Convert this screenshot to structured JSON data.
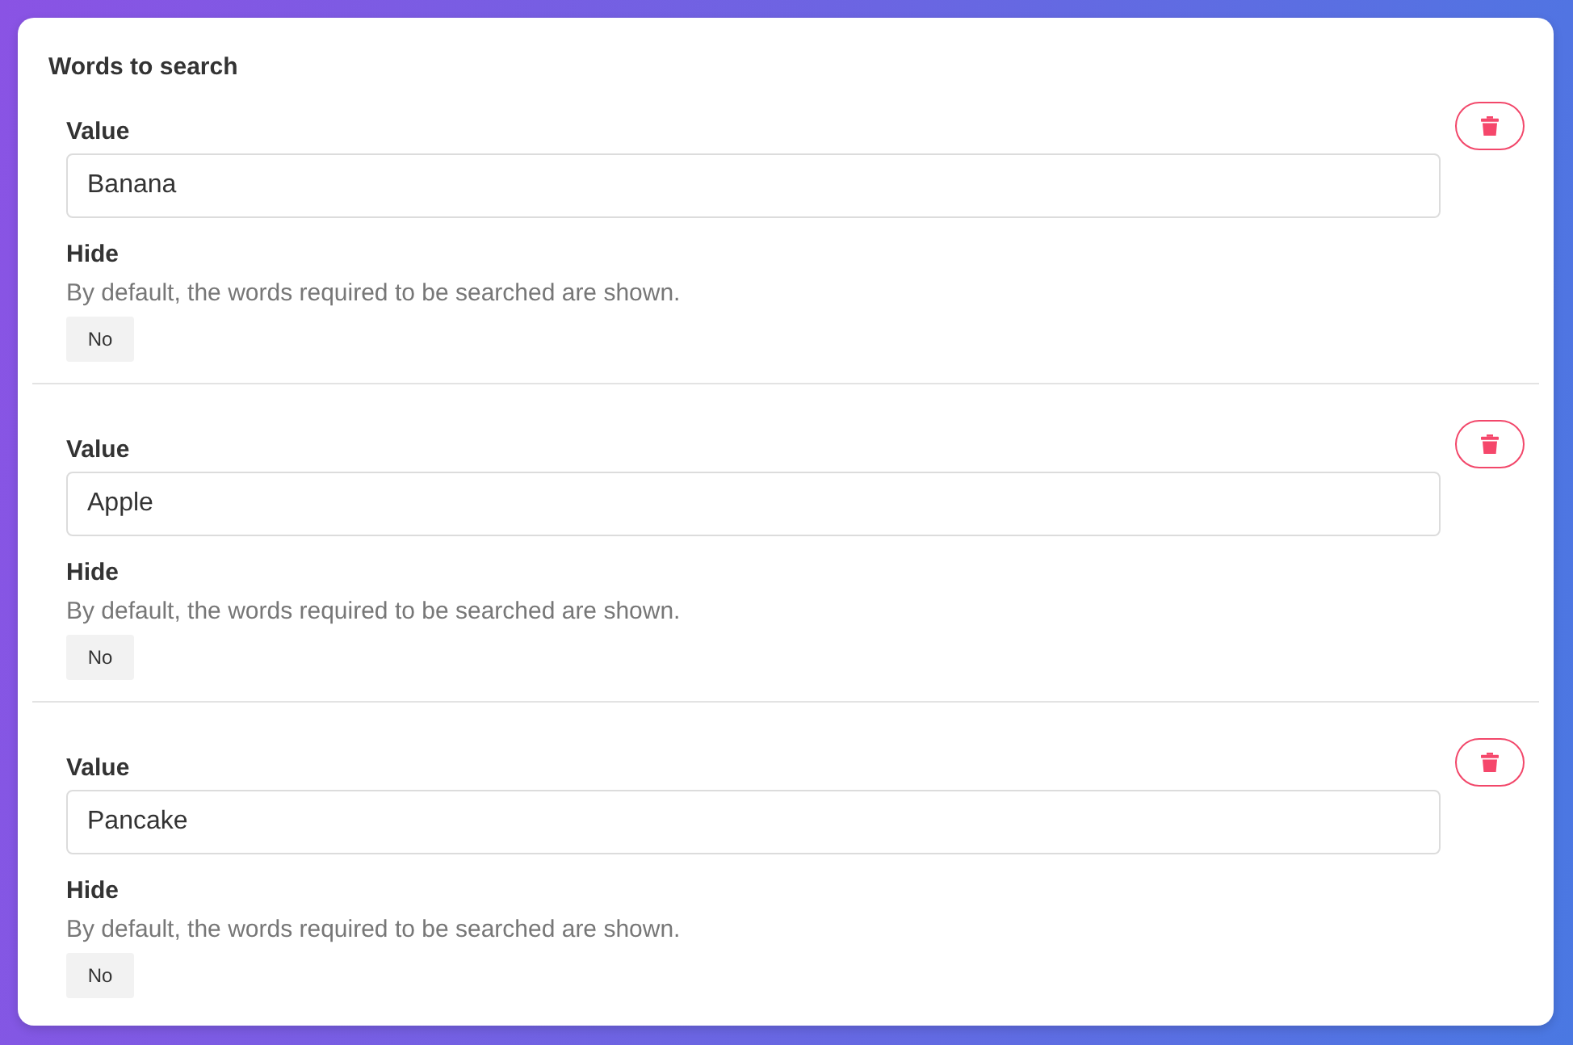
{
  "section": {
    "title": "Words to search"
  },
  "words": [
    {
      "value_label": "Value",
      "value": "Banana",
      "hide_label": "Hide",
      "hide_description": "By default, the words required to be searched are shown.",
      "hide_toggle": "No"
    },
    {
      "value_label": "Value",
      "value": "Apple",
      "hide_label": "Hide",
      "hide_description": "By default, the words required to be searched are shown.",
      "hide_toggle": "No"
    },
    {
      "value_label": "Value",
      "value": "Pancake",
      "hide_label": "Hide",
      "hide_description": "By default, the words required to be searched are shown.",
      "hide_toggle": "No"
    }
  ]
}
